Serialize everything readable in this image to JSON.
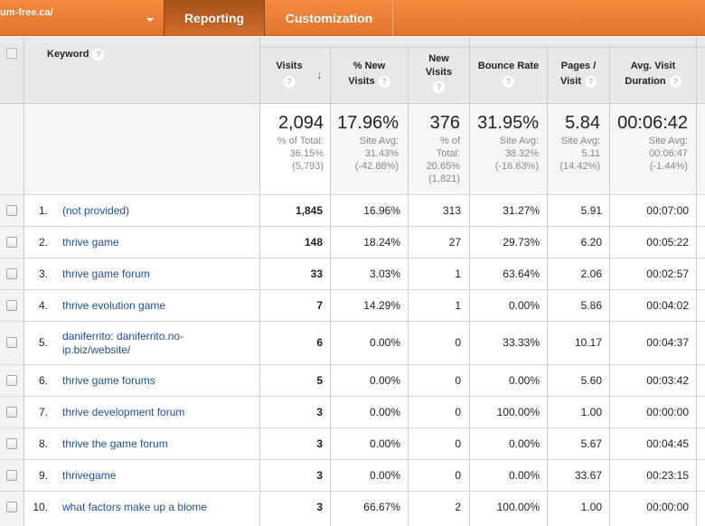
{
  "topbar": {
    "site_name": "um-free.ca/",
    "tabs": [
      {
        "label": "Reporting",
        "active": true
      },
      {
        "label": "Customization",
        "active": false
      }
    ],
    "colors": {
      "bar": "#f0823a",
      "active_tab": "#b85d1f"
    }
  },
  "table": {
    "columns": {
      "keyword": "Keyword",
      "visits": "Visits",
      "pct_new_visits_l1": "% New",
      "pct_new_visits_l2": "Visits",
      "new_visits_l1": "New",
      "new_visits_l2": "Visits",
      "bounce_rate": "Bounce Rate",
      "pages_visit_l1": "Pages /",
      "pages_visit_l2": "Visit",
      "avg_duration_l1": "Avg. Visit",
      "avg_duration_l2": "Duration"
    },
    "help_glyph": "?",
    "sort_glyph": "↓",
    "summary": {
      "visits": {
        "value": "2,094",
        "l1": "% of Total:",
        "l2": "36.15%",
        "l3": "(5,793)"
      },
      "pct_new": {
        "value": "17.96%",
        "l1": "Site Avg:",
        "l2": "31.43%",
        "l3": "(-42.88%)"
      },
      "new_visits": {
        "value": "376",
        "l1": "% of",
        "l2": "Total:",
        "l3": "20.65%",
        "l4": "(1,821)"
      },
      "bounce": {
        "value": "31.95%",
        "l1": "Site Avg:",
        "l2": "38.32%",
        "l3": "(-16.63%)"
      },
      "pages": {
        "value": "5.84",
        "l1": "Site Avg:",
        "l2": "5.11",
        "l3": "(14.42%)"
      },
      "duration": {
        "value": "00:06:42",
        "l1": "Site Avg:",
        "l2": "00:06:47",
        "l3": "(-1.44%)"
      }
    },
    "rows": [
      {
        "rank": "1.",
        "keyword": "(not provided)",
        "visits": "1,845",
        "pct_new": "16.96%",
        "new_visits": "313",
        "bounce": "31.27%",
        "pages": "5.91",
        "duration": "00:07:00"
      },
      {
        "rank": "2.",
        "keyword": "thrive game",
        "visits": "148",
        "pct_new": "18.24%",
        "new_visits": "27",
        "bounce": "29.73%",
        "pages": "6.20",
        "duration": "00:05:22"
      },
      {
        "rank": "3.",
        "keyword": "thrive game forum",
        "visits": "33",
        "pct_new": "3.03%",
        "new_visits": "1",
        "bounce": "63.64%",
        "pages": "2.06",
        "duration": "00:02:57"
      },
      {
        "rank": "4.",
        "keyword": "thrive evolution game",
        "visits": "7",
        "pct_new": "14.29%",
        "new_visits": "1",
        "bounce": "0.00%",
        "pages": "5.86",
        "duration": "00:04:02"
      },
      {
        "rank": "5.",
        "keyword": "daniferrito: daniferrito.no-ip.biz/website/",
        "keyword_l1": "daniferrito: daniferrito.no-",
        "keyword_l2": "ip.biz/website/",
        "visits": "6",
        "pct_new": "0.00%",
        "new_visits": "0",
        "bounce": "33.33%",
        "pages": "10.17",
        "duration": "00:04:37"
      },
      {
        "rank": "6.",
        "keyword": "thrive game forums",
        "visits": "5",
        "pct_new": "0.00%",
        "new_visits": "0",
        "bounce": "0.00%",
        "pages": "5.60",
        "duration": "00:03:42"
      },
      {
        "rank": "7.",
        "keyword": "thrive development forum",
        "visits": "3",
        "pct_new": "0.00%",
        "new_visits": "0",
        "bounce": "100.00%",
        "pages": "1.00",
        "duration": "00:00:00"
      },
      {
        "rank": "8.",
        "keyword": "thrive the game forum",
        "visits": "3",
        "pct_new": "0.00%",
        "new_visits": "0",
        "bounce": "0.00%",
        "pages": "5.67",
        "duration": "00:04:45"
      },
      {
        "rank": "9.",
        "keyword": "thrivegame",
        "visits": "3",
        "pct_new": "0.00%",
        "new_visits": "0",
        "bounce": "0.00%",
        "pages": "33.67",
        "duration": "00:23:15"
      },
      {
        "rank": "10.",
        "keyword": "what factors make up a biome",
        "visits": "3",
        "pct_new": "66.67%",
        "new_visits": "2",
        "bounce": "100.00%",
        "pages": "1.00",
        "duration": "00:00:00"
      }
    ]
  }
}
